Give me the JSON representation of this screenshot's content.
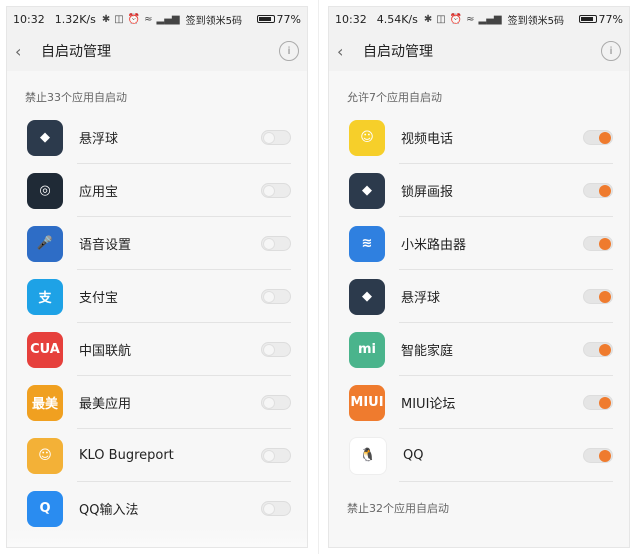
{
  "colors": {
    "toggle_on": "#ef7b2e"
  },
  "left": {
    "status": {
      "time": "10:32",
      "speed": "1.32K/s",
      "carrier": "签到领米5码",
      "battery": "77%"
    },
    "title": "自启动管理",
    "section": "禁止33个应用自启动",
    "apps": [
      {
        "name": "悬浮球",
        "icon": "android-robot-icon",
        "icon_text": "◆",
        "color": "#2c3a4c",
        "state": "off"
      },
      {
        "name": "应用宝",
        "icon": "yingyongbao-icon",
        "icon_text": "◎",
        "color": "#1f2a36",
        "state": "off"
      },
      {
        "name": "语音设置",
        "icon": "voice-settings-icon",
        "icon_text": "🎤",
        "color": "#2e6dc6",
        "state": "off"
      },
      {
        "name": "支付宝",
        "icon": "alipay-icon",
        "icon_text": "支",
        "color": "#1ea2e6",
        "state": "off"
      },
      {
        "name": "中国联航",
        "icon": "china-united-airlines-icon",
        "icon_text": "CUA",
        "color": "#e6403c",
        "state": "off"
      },
      {
        "name": "最美应用",
        "icon": "zuimei-icon",
        "icon_text": "最美",
        "color": "#f0a020",
        "state": "off"
      },
      {
        "name": "KLO Bugreport",
        "icon": "klo-bugreport-icon",
        "icon_text": "☺",
        "color": "#f3b137",
        "state": "off"
      },
      {
        "name": "QQ输入法",
        "icon": "qq-input-icon",
        "icon_text": "Q",
        "color": "#2a8cf0",
        "state": "off"
      }
    ]
  },
  "right": {
    "status": {
      "time": "10:32",
      "speed": "4.54K/s",
      "carrier": "签到领米5码",
      "battery": "77%"
    },
    "title": "自启动管理",
    "section": "允许7个应用自启动",
    "section2": "禁止32个应用自启动",
    "apps": [
      {
        "name": "视频电话",
        "icon": "video-call-icon",
        "icon_text": "☺",
        "color": "#f6cf2a",
        "state": "on"
      },
      {
        "name": "锁屏画报",
        "icon": "android-robot-icon",
        "icon_text": "◆",
        "color": "#2c3a4c",
        "state": "on"
      },
      {
        "name": "小米路由器",
        "icon": "mi-router-icon",
        "icon_text": "≋",
        "color": "#2f80e0",
        "state": "on"
      },
      {
        "name": "悬浮球",
        "icon": "android-robot-icon",
        "icon_text": "◆",
        "color": "#2c3a4c",
        "state": "on"
      },
      {
        "name": "智能家庭",
        "icon": "smart-home-icon",
        "icon_text": "mi",
        "color": "#4ab48c",
        "state": "on"
      },
      {
        "name": "MIUI论坛",
        "icon": "miui-forum-icon",
        "icon_text": "MIUI",
        "color": "#ef7b2e",
        "state": "on"
      },
      {
        "name": "QQ",
        "icon": "qq-penguin-icon",
        "icon_text": "🐧",
        "color": "#ffffff",
        "state": "on"
      }
    ]
  }
}
